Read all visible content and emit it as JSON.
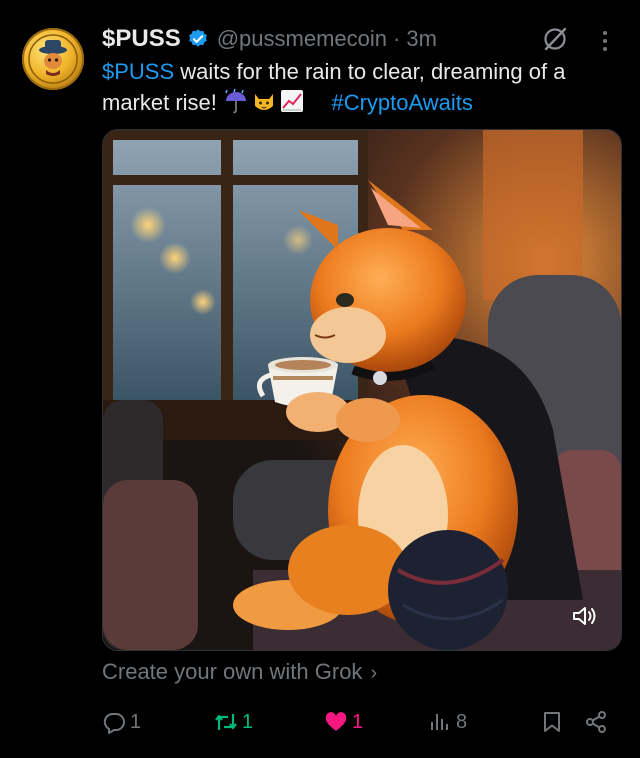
{
  "post": {
    "display_name": "$PUSS",
    "handle": "@pussmemecoin",
    "separator": "·",
    "time": "3m",
    "text_ticker": "$PUSS",
    "text_body": " waits for the rain to clear, dreaming of a market rise! ",
    "hashtag": "#CryptoAwaits",
    "emojis": [
      "umbrella-with-rain-icon",
      "cat-face-icon",
      "chart-increasing-icon"
    ]
  },
  "media": {
    "alt": "Orange cat in a cape sipping tea by a rainy window",
    "mute_icon": "speaker-icon"
  },
  "grok": {
    "label": "Create your own with Grok",
    "chevron": "›"
  },
  "actions": {
    "replies": "1",
    "reposts": "1",
    "likes": "1",
    "views": "8"
  },
  "colors": {
    "accent": "#1d9bf0",
    "repost": "#00ba7c",
    "like": "#f91880",
    "muted": "#71767b",
    "text": "#e7e9ea"
  }
}
